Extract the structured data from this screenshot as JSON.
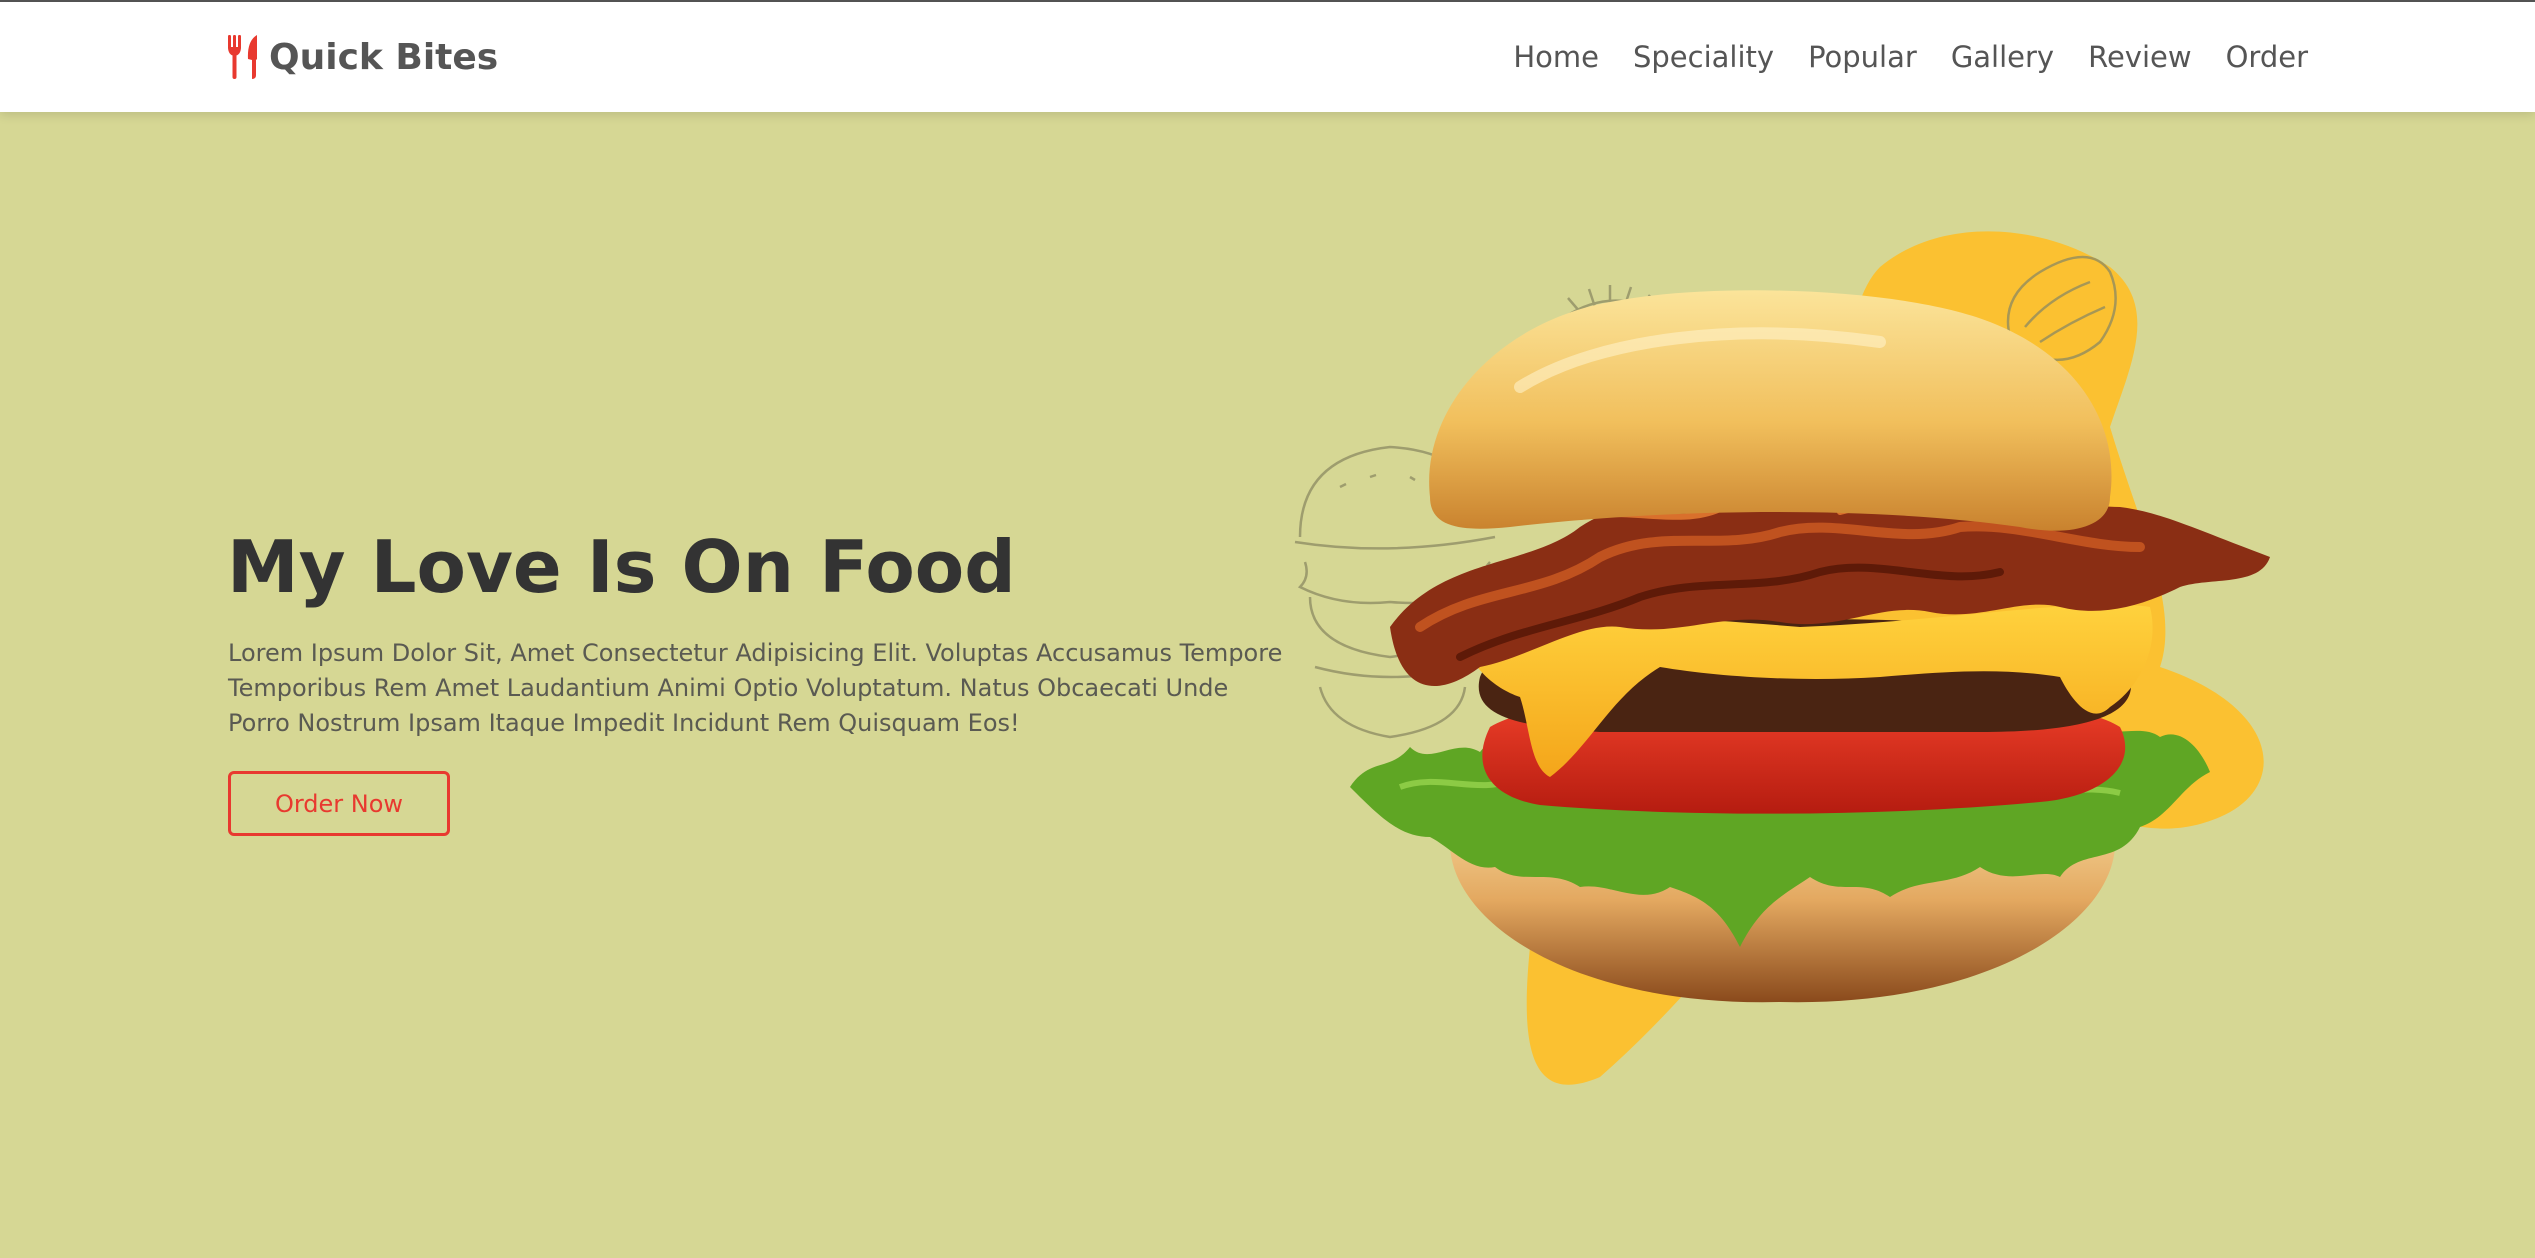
{
  "header": {
    "logo_icon": "utensils-icon",
    "logo_text": "Quick Bites",
    "nav": [
      {
        "label": "Home"
      },
      {
        "label": "Speciality"
      },
      {
        "label": "Popular"
      },
      {
        "label": "Gallery"
      },
      {
        "label": "Review"
      },
      {
        "label": "Order"
      }
    ]
  },
  "hero": {
    "title": "My Love Is On Food",
    "description": "Lorem Ipsum Dolor Sit, Amet Consectetur Adipisicing Elit. Voluptas Accusamus Tempore Temporibus Rem Amet Laudantium Animi Optio Voluptatum. Natus Obcaecati Unde Porro Nostrum Ipsam Itaque Impedit Incidunt Rem Quisquam Eos!",
    "button_label": "Order Now",
    "image_subject": "burger-image"
  },
  "colors": {
    "background": "#d6d794",
    "accent": "#e8392f",
    "blob": "#fbc131",
    "text_dark": "#333333",
    "text_muted": "#555555"
  }
}
